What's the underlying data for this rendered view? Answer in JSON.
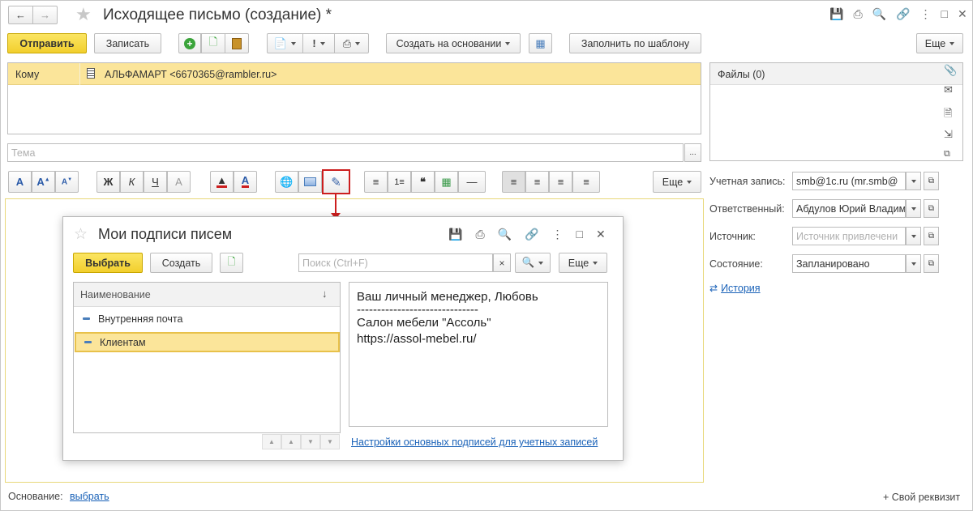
{
  "window": {
    "title": "Исходящее письмо  (создание) *"
  },
  "toolbar": {
    "send": "Отправить",
    "save": "Записать",
    "create_based": "Создать на основании",
    "fill_template": "Заполнить по шаблону",
    "more": "Еще"
  },
  "recipients": {
    "to_label": "Кому",
    "to_value": "АЛЬФАМАРТ <6670365@rambler.ru>"
  },
  "files": {
    "label": "Файлы (0)"
  },
  "subject": {
    "placeholder": "Тема",
    "select_btn": "..."
  },
  "editor": {
    "more": "Еще"
  },
  "fields": {
    "account_label": "Учетная запись:",
    "account_value": "smb@1c.ru (mr.smb@",
    "responsible_label": "Ответственный:",
    "responsible_value": "Абдулов Юрий Владим",
    "source_label": "Источник:",
    "source_placeholder": "Источник привлечени",
    "state_label": "Состояние:",
    "state_value": "Запланировано",
    "history_link": "История"
  },
  "footer": {
    "basis_label": "Основание:",
    "basis_link": "выбрать",
    "custom_attr": "+ Свой реквизит"
  },
  "dialog": {
    "title": "Мои подписи писем",
    "select": "Выбрать",
    "create": "Создать",
    "search_placeholder": "Поиск (Ctrl+F)",
    "clear": "×",
    "more": "Еще",
    "column_header": "Наименование",
    "sort_icon": "↓",
    "items": [
      {
        "label": "Внутренняя почта"
      },
      {
        "label": "Клиентам"
      }
    ],
    "preview_lines": [
      "Ваш личный менеджер, Любовь",
      "------------------------------",
      "Салон мебели \"Ассоль\"",
      "https://assol-mebel.ru/"
    ],
    "settings_link": "Настройки основных подписей для учетных записей"
  },
  "colors": {
    "accent_yellow": "#f2cf2d",
    "selection_yellow": "#fbe59a",
    "highlight_red": "#cc1e1e",
    "link_blue": "#1a62b8"
  }
}
